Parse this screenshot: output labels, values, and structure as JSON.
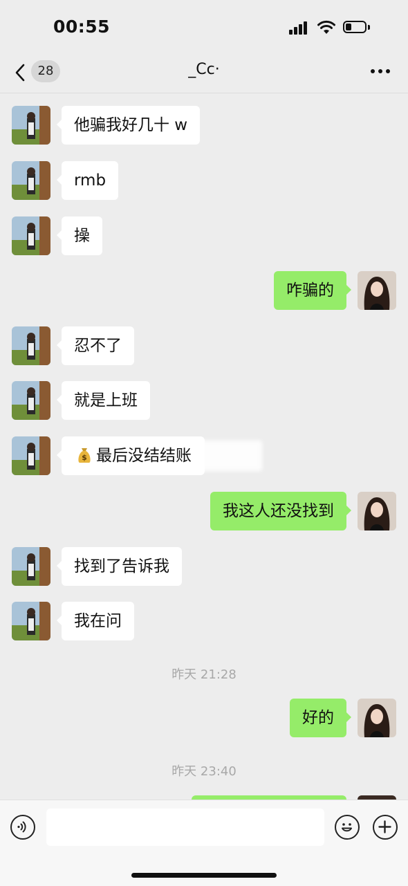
{
  "status_bar": {
    "time": "00:55"
  },
  "nav": {
    "unread_count": "28",
    "title": "_Cc·"
  },
  "messages": [
    {
      "side": "in",
      "text": "他骗我好几十 w"
    },
    {
      "side": "in",
      "text": "rmb"
    },
    {
      "side": "in",
      "text": "操"
    },
    {
      "side": "out",
      "text": "咋骗的"
    },
    {
      "side": "in",
      "text": "忍不了"
    },
    {
      "side": "in",
      "text": "就是上班"
    },
    {
      "side": "in",
      "text": "最后没结结账",
      "icon": "money-bag-icon"
    },
    {
      "side": "out",
      "text": "我这人还没找到"
    },
    {
      "side": "in",
      "text": "找到了告诉我"
    },
    {
      "side": "in",
      "text": "我在问"
    },
    {
      "side": "out",
      "text": "好的"
    }
  ],
  "timestamps": [
    "昨天 21:28",
    "昨天 23:40"
  ],
  "input_bar": {
    "voice_icon": "voice-icon",
    "emoji_icon": "emoji-icon",
    "plus_icon": "plus-icon"
  },
  "colors": {
    "outgoing_bubble": "#95ec69",
    "incoming_bubble": "#ffffff",
    "background": "#ededed"
  }
}
